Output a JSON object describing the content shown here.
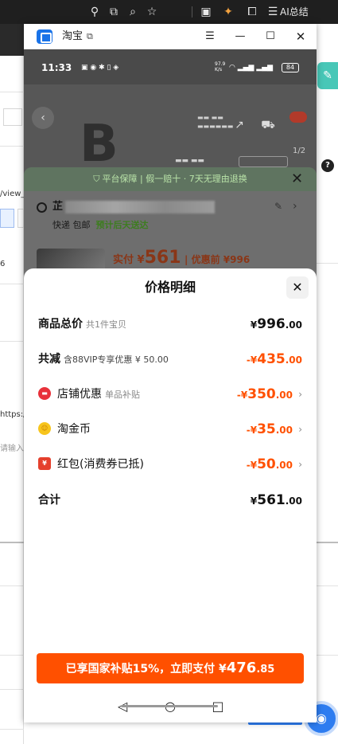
{
  "browser": {
    "ai_summary": "AI总结"
  },
  "background_page": {
    "url_fragment": "/view_",
    "field_value": "6",
    "url_text": "https:/",
    "placeholder": "请输入"
  },
  "window": {
    "title": "淘宝"
  },
  "phone": {
    "status_bar": {
      "time": "11:33",
      "net_speed": "97.9",
      "net_unit": "K/s",
      "battery": "84"
    },
    "product_view": {
      "pager": "1/2"
    },
    "order_sheet": {
      "guarantee": "平台保障 | 假一赔十 · 7天无理由退换",
      "address_initial": "芷",
      "shipping": "快递 包邮",
      "delivery": "预计后天送达",
      "paid_label": "实付 ¥",
      "paid_amount": "561",
      "before_discount": "| 优惠前 ¥996"
    },
    "price_detail": {
      "title": "价格明细",
      "rows": [
        {
          "label": "商品总价",
          "sub": "共1件宝贝",
          "currency": "¥",
          "integer": "996",
          "decimal": ".00"
        },
        {
          "label": "共减",
          "sub": "含88VIP专享优惠 ¥ 50.00",
          "currency": "-¥",
          "integer": "435",
          "decimal": ".00"
        },
        {
          "label": "店铺优惠",
          "sub": "单品补贴",
          "currency": "-¥",
          "integer": "350",
          "decimal": ".00"
        },
        {
          "label": "淘金币",
          "sub": "",
          "currency": "-¥",
          "integer": "35",
          "decimal": ".00"
        },
        {
          "label": "红包(消费券已抵)",
          "sub": "",
          "currency": "-¥",
          "integer": "50",
          "decimal": ".00"
        },
        {
          "label": "合计",
          "sub": "",
          "currency": "¥",
          "integer": "561",
          "decimal": ".00"
        }
      ],
      "pay_button": {
        "prefix": "已享国家补贴15%，立即支付 ¥",
        "integer": "476",
        "decimal": ".85"
      }
    }
  }
}
